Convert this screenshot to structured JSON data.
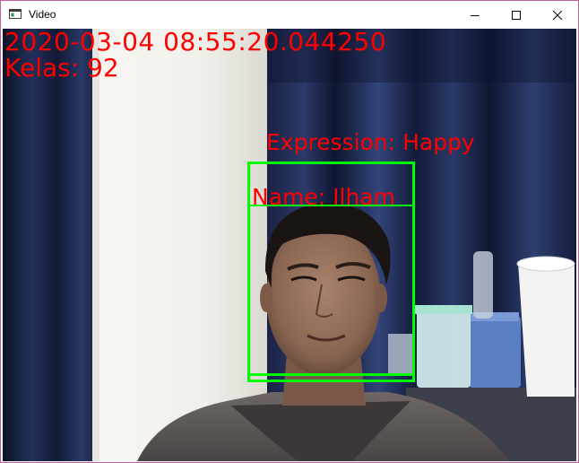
{
  "window": {
    "title": "Video",
    "icon": "app-window-icon",
    "controls": [
      "minimize-icon",
      "maximize-icon",
      "close-icon"
    ]
  },
  "overlay": {
    "timestamp": "2020-03-04 08:55:20.044250",
    "kelas": "Kelas: 92",
    "expression": "Expression: Happy",
    "name": "Name: Ilham",
    "text_color": "#ff0000",
    "box_color": "#00ff00"
  }
}
